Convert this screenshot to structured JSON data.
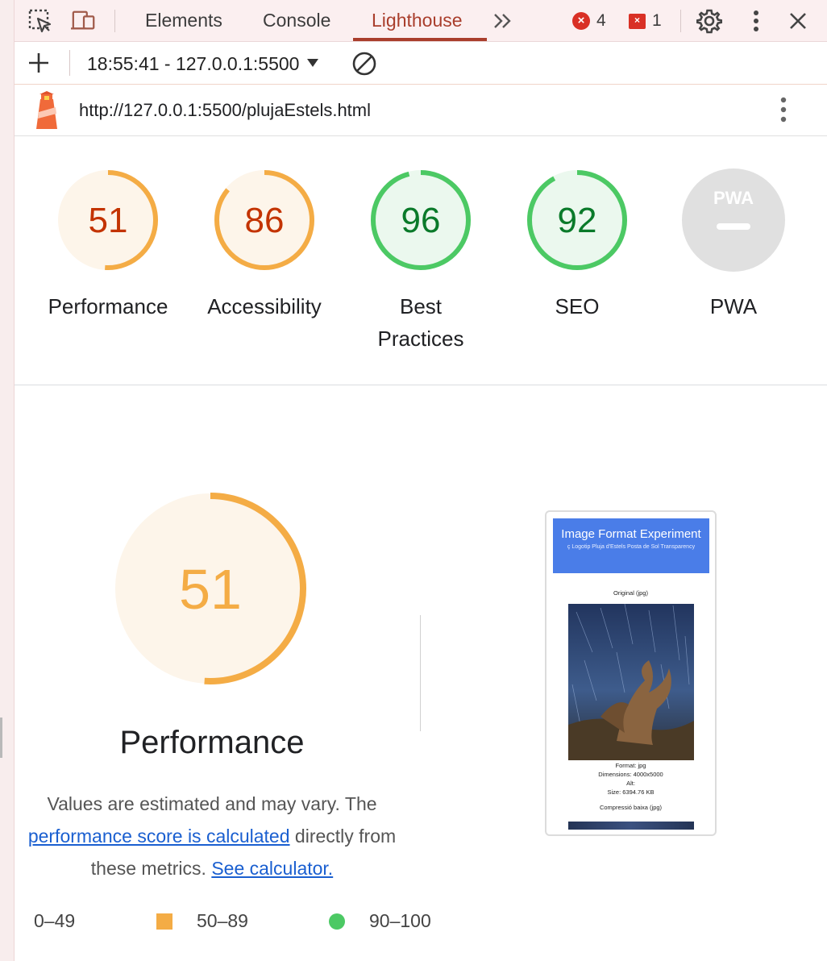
{
  "devtools": {
    "tabs": [
      {
        "label": "Elements"
      },
      {
        "label": "Console"
      },
      {
        "label": "Lighthouse"
      }
    ],
    "errors_count": "4",
    "issues_count": "1",
    "issue_badge_glyph": "×",
    "error_badge_glyph": "×"
  },
  "report": {
    "selector_label": "18:55:41 - 127.0.0.1:5500",
    "url": "http://127.0.0.1:5500/plujaEstels.html"
  },
  "colors": {
    "average": "#f4ac45",
    "average_text": "#c33300",
    "pass": "#4cc964",
    "pass_text": "#0a7a2a",
    "fail": "#e8443a",
    "na": "#e0e0e0",
    "accent": "#a93e2c"
  },
  "gauges": [
    {
      "score": "51",
      "value": 51,
      "label": "Performance",
      "rating": "average"
    },
    {
      "score": "86",
      "value": 86,
      "label": "Accessibility",
      "rating": "average"
    },
    {
      "score": "96",
      "value": 96,
      "label": "Best Practices",
      "label_line1": "Best",
      "label_line2": "Practices",
      "rating": "pass"
    },
    {
      "score": "92",
      "value": 92,
      "label": "SEO",
      "rating": "pass"
    },
    {
      "score": "",
      "label": "PWA",
      "badge_text": "PWA",
      "rating": "na"
    }
  ],
  "performance": {
    "score": "51",
    "value": 51,
    "title": "Performance",
    "desc_part1": "Values are estimated and may vary. The",
    "desc_link1": "performance score is calculated",
    "desc_part2": "directly from",
    "desc_part3": "these metrics.",
    "desc_link2": "See calculator."
  },
  "legend": [
    {
      "range": "0–49",
      "shape": "triangle",
      "color": "#e8443a"
    },
    {
      "range": "50–89",
      "shape": "square",
      "color": "#f4ac45"
    },
    {
      "range": "90–100",
      "shape": "circle",
      "color": "#4cc964"
    }
  ],
  "screenshot": {
    "title": "Image Format Experiment",
    "subtitle": "ç Logotip Pluja d'Estels Posta de Sol Transparency",
    "original_label": "Original (jpg)",
    "format": "Format: jpg",
    "dimensions": "Dimensions: 4000x5000",
    "alt": "Alt:",
    "size": "Size: 6394.76 KB",
    "compression": "Compressió baixa (jpg)"
  },
  "icons": {
    "inspect": "inspect-element-icon",
    "device": "device-toolbar-icon",
    "more_tabs": "more-tabs-chevron-icon",
    "settings": "gear-icon",
    "menu": "kebab-menu-icon",
    "close": "close-icon",
    "new_report": "plus-icon",
    "clear": "block-icon",
    "lighthouse": "lighthouse-logo-icon"
  }
}
